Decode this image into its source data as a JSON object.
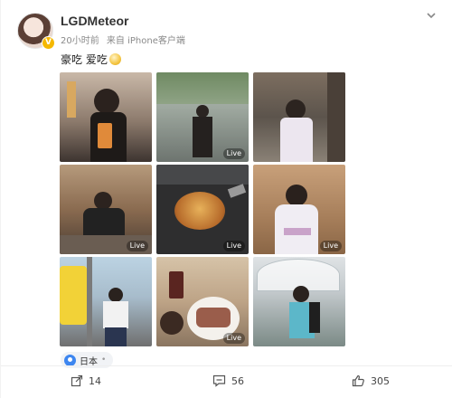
{
  "user": {
    "name": "LGDMeteor",
    "verified_badge": "V"
  },
  "meta": {
    "time": "20小时前",
    "source": "来自 iPhone客户端"
  },
  "post": {
    "text": "豪吃 爱吃",
    "emoji_icon": "emoji-drool-icon"
  },
  "photos": [
    {
      "subject": "man-with-drink",
      "live": ""
    },
    {
      "subject": "man-under-trees",
      "live": "Live"
    },
    {
      "subject": "woman-in-yukata-street",
      "live": ""
    },
    {
      "subject": "man-in-restaurant",
      "live": "Live"
    },
    {
      "subject": "okonomiyaki-grill",
      "live": "Live"
    },
    {
      "subject": "woman-in-yukata-room",
      "live": "Live"
    },
    {
      "subject": "woman-by-bus",
      "live": ""
    },
    {
      "subject": "steak-dinner",
      "live": "Live"
    },
    {
      "subject": "man-with-umbrella",
      "live": ""
    }
  ],
  "location": {
    "label": "日本",
    "dot": "•"
  },
  "actions": {
    "share_count": "14",
    "comment_count": "56",
    "like_count": "305"
  },
  "colors": {
    "verified": "#f5b800",
    "location_pin": "#3d86f0"
  }
}
